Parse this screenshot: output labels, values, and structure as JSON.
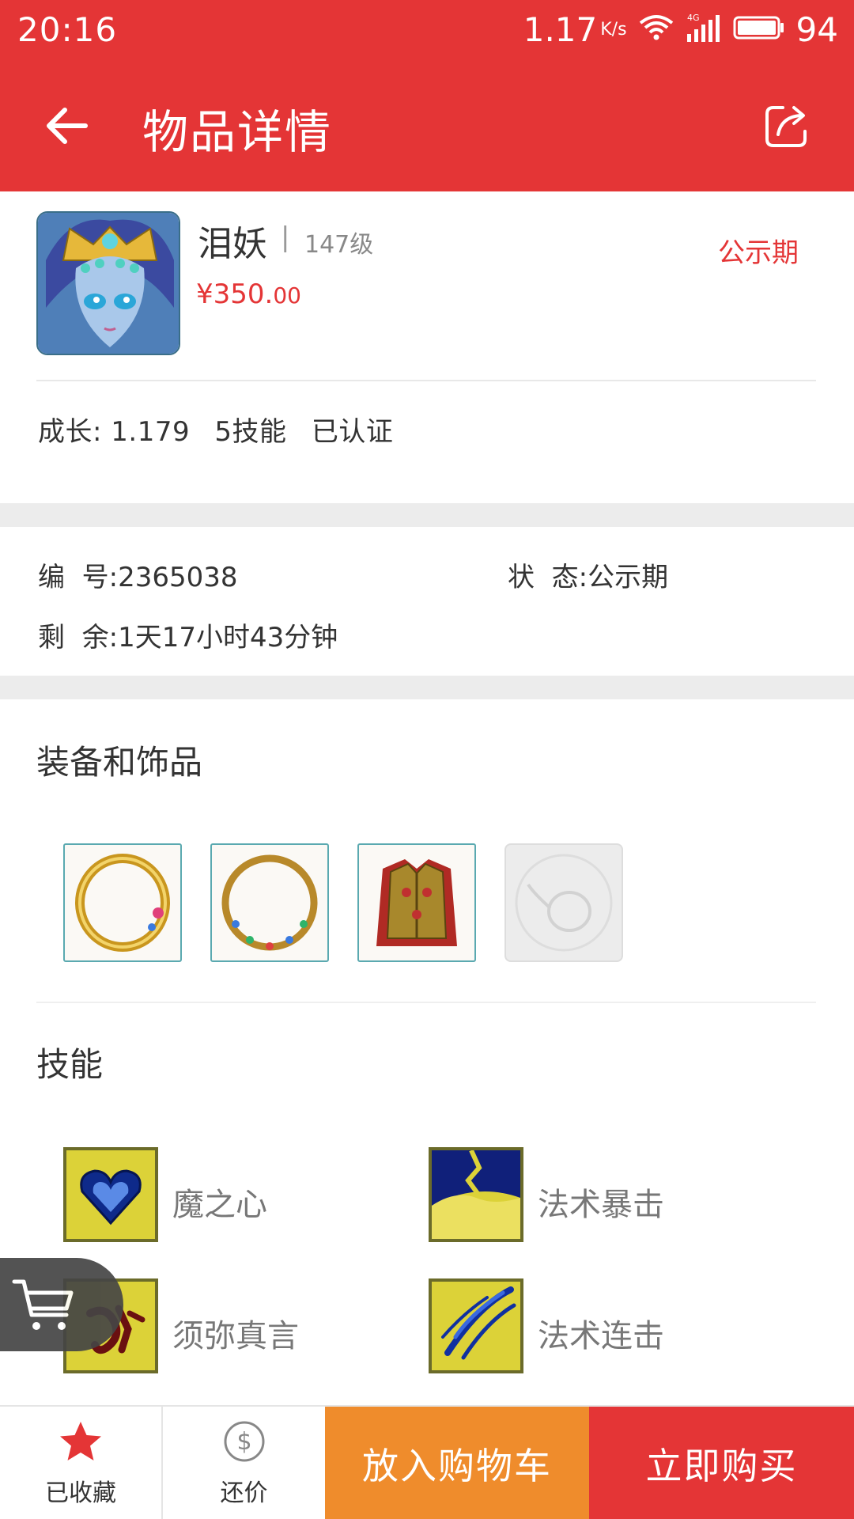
{
  "status_bar": {
    "time": "20:16",
    "network_speed": "1.17",
    "network_speed_unit": "K/s",
    "network_type": "4G",
    "battery_percent": "94"
  },
  "app_bar": {
    "title": "物品详情",
    "back_icon": "back-arrow-icon",
    "share_icon": "share-icon"
  },
  "product": {
    "name": "泪妖",
    "separator": "|",
    "level": "147级",
    "price_main": "¥350.",
    "price_cents": "00",
    "status_tag": "公示期",
    "attributes": [
      "成长: 1.179",
      "5技能",
      "已认证"
    ]
  },
  "info": {
    "id_label": "编  号:",
    "id_value": "2365038",
    "state_label": "状  态:",
    "state_value": "公示期",
    "remaining_label": "剩  余:",
    "remaining_value": "1天17小时43分钟"
  },
  "equipment": {
    "title": "装备和饰品",
    "items": [
      "ring-1",
      "ring-2",
      "armor",
      "empty-slot"
    ]
  },
  "skills": {
    "title": "技能",
    "items": [
      "魔之心",
      "法术暴击",
      "须弥真言",
      "法术连击"
    ]
  },
  "bottom_bar": {
    "favorite_label": "已收藏",
    "bargain_label": "还价",
    "add_to_cart_label": "放入购物车",
    "buy_now_label": "立即购买"
  },
  "colors": {
    "primary_red": "#e43536",
    "orange": "#ef8c2c",
    "gap_gray": "#ececec"
  }
}
